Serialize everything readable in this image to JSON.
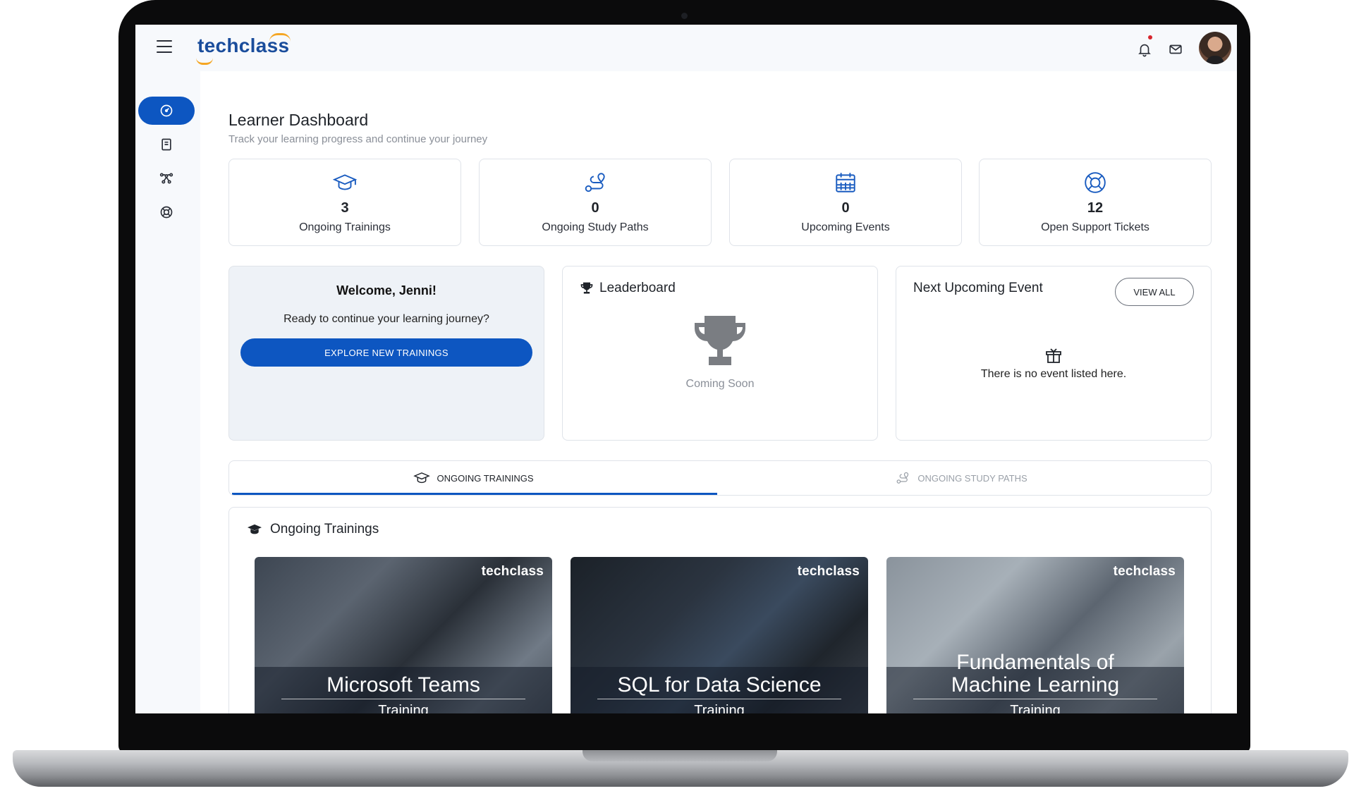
{
  "app": {
    "logo_text": "techclass"
  },
  "page": {
    "title": "Learner Dashboard",
    "subtitle": "Track your learning progress and continue your journey"
  },
  "stats": [
    {
      "value": "3",
      "label": "Ongoing Trainings",
      "icon": "graduation-cap-icon"
    },
    {
      "value": "0",
      "label": "Ongoing Study Paths",
      "icon": "route-icon"
    },
    {
      "value": "0",
      "label": "Upcoming Events",
      "icon": "calendar-icon"
    },
    {
      "value": "12",
      "label": "Open Support Tickets",
      "icon": "lifebuoy-icon"
    }
  ],
  "welcome": {
    "title": "Welcome, Jenni!",
    "text": "Ready to continue your learning journey?",
    "button": "EXPLORE NEW TRAININGS"
  },
  "leaderboard": {
    "title": "Leaderboard",
    "status": "Coming Soon"
  },
  "next_event": {
    "title": "Next Upcoming Event",
    "view_all": "VIEW ALL",
    "empty_text": "There is no event listed here."
  },
  "tabs": [
    {
      "label": "ONGOING TRAININGS",
      "active": true
    },
    {
      "label": "ONGOING STUDY PATHS",
      "active": false
    }
  ],
  "trainings": {
    "title": "Ongoing Trainings",
    "courses": [
      {
        "title": "Microsoft Teams",
        "subtitle": "Training",
        "brand": "techclass"
      },
      {
        "title": "SQL for Data Science",
        "subtitle": "Training",
        "brand": "techclass"
      },
      {
        "title": "Fundamentals of Machine Learning",
        "subtitle": "Training",
        "brand": "techclass"
      }
    ]
  },
  "colors": {
    "primary": "#0d56c1",
    "logo": "#1a4d9c",
    "accent": "#f5a623",
    "notification": "#d7262e"
  }
}
